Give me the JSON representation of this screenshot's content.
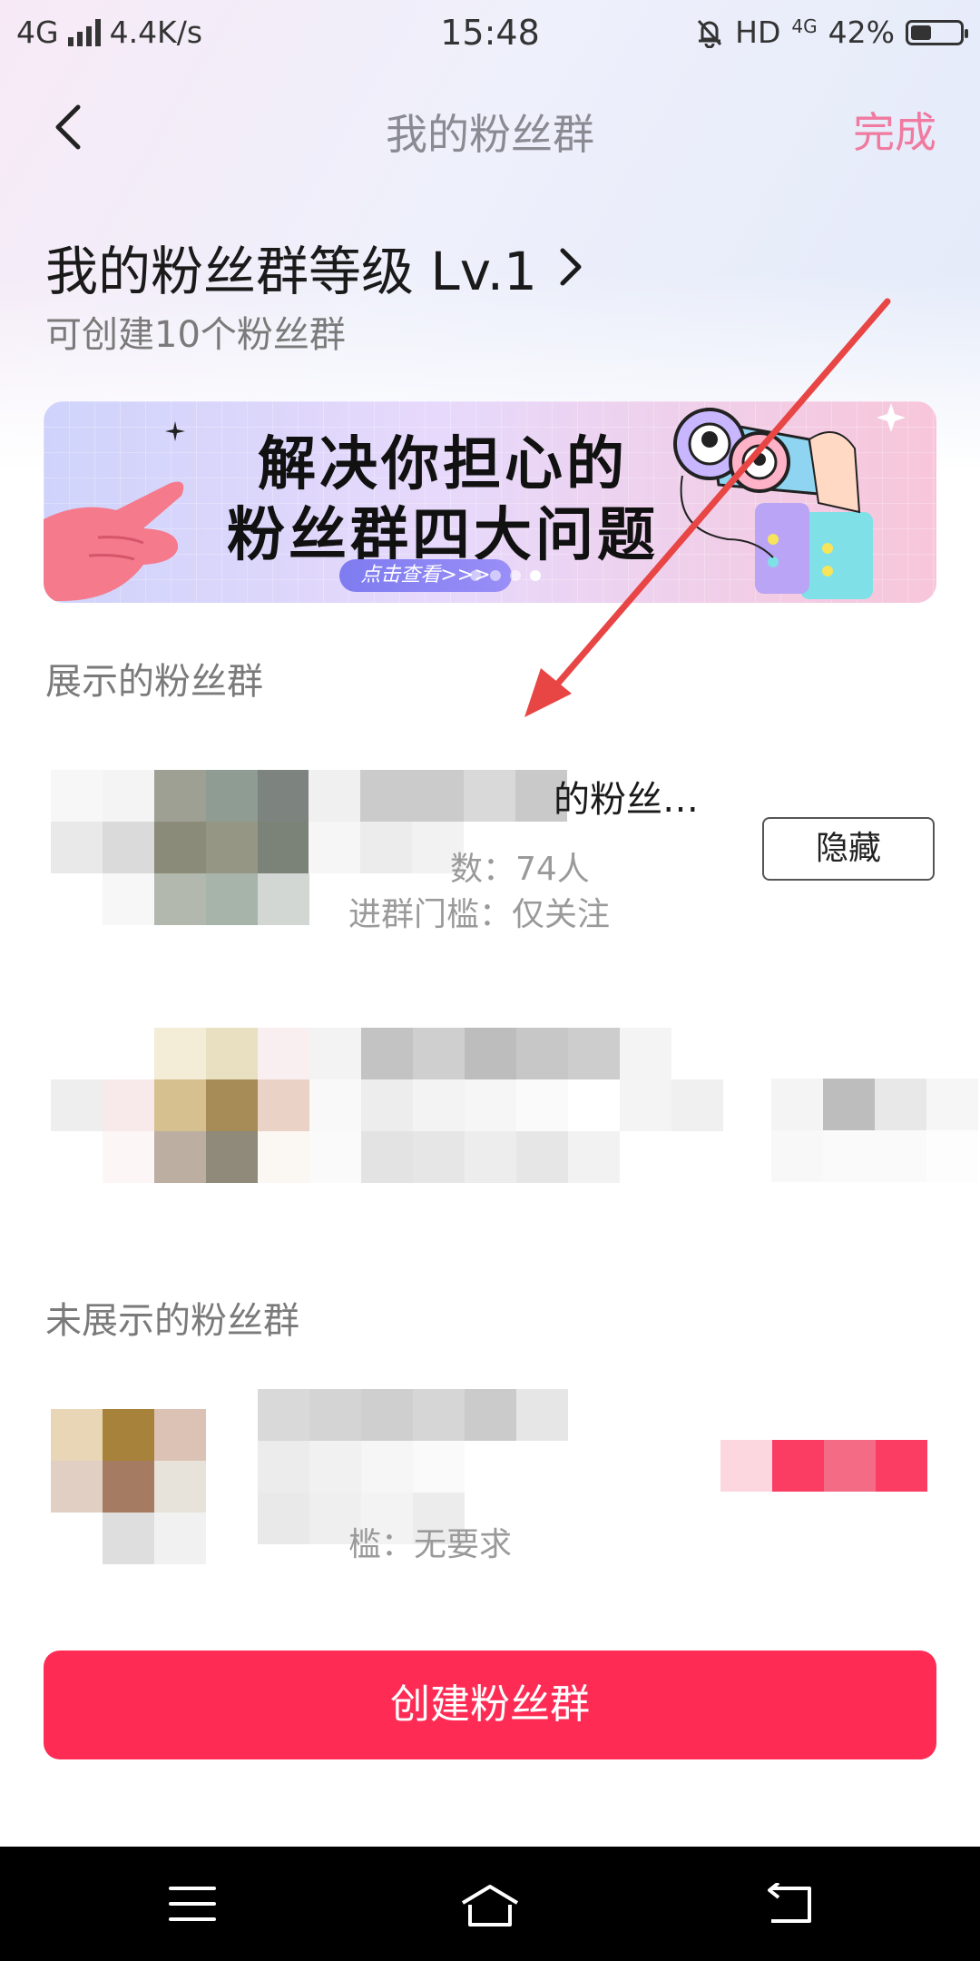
{
  "status_bar": {
    "network": "4G",
    "speed": "4.4K/s",
    "time": "15:48",
    "hd": "HD",
    "net2": "4G",
    "battery": "42%",
    "battery_level": 0.42
  },
  "nav": {
    "title": "我的粉丝群",
    "done_label": "完成"
  },
  "level": {
    "title": "我的粉丝群等级 Lv.1",
    "subtitle": "可创建10个粉丝群"
  },
  "banner": {
    "line1": "解决你担心的",
    "line2": "粉丝群四大问题",
    "cta": "点击查看>>>"
  },
  "sections": {
    "shown": "展示的粉丝群",
    "hidden": "未展示的粉丝群"
  },
  "groups": {
    "g1_name": "的粉丝…",
    "g1_members": "数：74人",
    "g1_threshold": "进群门槛：仅关注",
    "g1_action": "隐藏",
    "g3_threshold": "槛：无要求"
  },
  "create_label": "创建粉丝群",
  "colors": {
    "accent": "#fe2c55",
    "done": "#f07aa0",
    "annotation_arrow": "#e84545"
  }
}
